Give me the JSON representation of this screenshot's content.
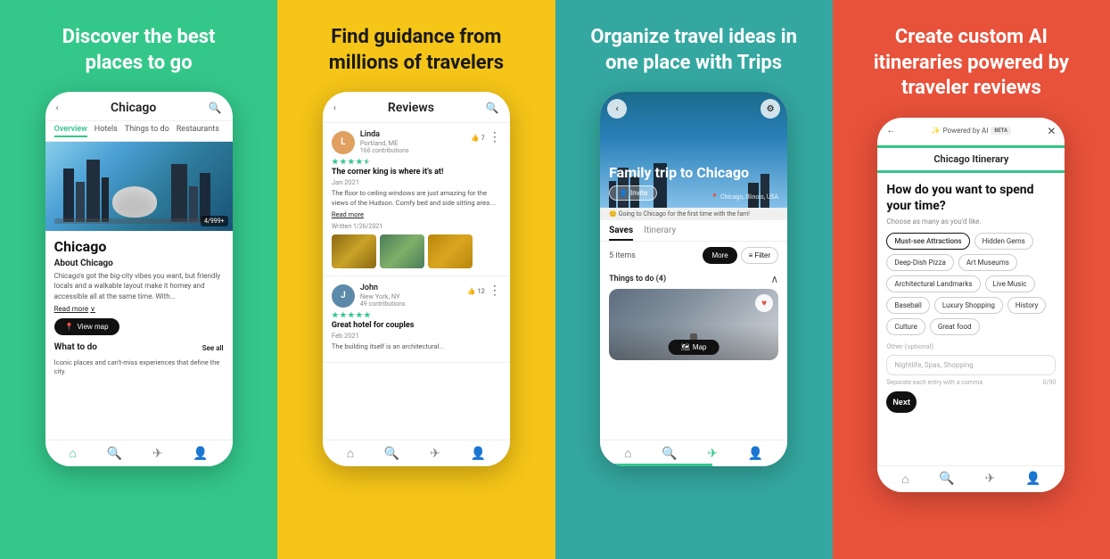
{
  "panels": [
    {
      "id": "panel-1",
      "title": "Discover the best places to go",
      "bg": "#34C78A",
      "phone": {
        "header": {
          "back_icon": "‹",
          "title": "Chicago",
          "search_icon": "🔍"
        },
        "tabs": [
          "Overview",
          "Hotels",
          "Things to do",
          "Restaurants"
        ],
        "active_tab": "Overview",
        "hero_count": "4/999+",
        "city_name": "Chicago",
        "about_title": "About Chicago",
        "about_text": "Chicago's got the big-city vibes you want, but friendly locals and a walkable layout make it homey and accessible all at the same time. With...",
        "read_more": "Read more",
        "view_map": "View map",
        "what_to_do": "What to do",
        "see_all": "See all",
        "what_desc": "Iconic places and can't-miss experiences that define the city."
      }
    },
    {
      "id": "panel-2",
      "title": "Find guidance from millions of travelers",
      "bg": "#F5C518",
      "phone": {
        "header": {
          "back_icon": "‹",
          "title": "Reviews",
          "search_icon": "🔍"
        },
        "reviews": [
          {
            "name": "Linda",
            "location": "Portland, ME",
            "contributions": "166 contributions",
            "stars": 4.5,
            "likes": 7,
            "title": "The corner king is where it's at!",
            "date": "Jan 2021",
            "text": "The floor to ceiling windows are just amazing for the views of the Hudson. Comfy bed and side sitting area....",
            "read_more": "Read more",
            "written": "Written 1/26/2021",
            "has_photos": true
          },
          {
            "name": "John",
            "location": "New York, NY",
            "contributions": "49 contributions",
            "stars": 5,
            "likes": 12,
            "title": "Great hotel for couples",
            "date": "Feb 2021",
            "text": "The building itself is an architectural...",
            "read_more": "",
            "written": "",
            "has_photos": false
          }
        ]
      }
    },
    {
      "id": "panel-3",
      "title": "Organize travel ideas in one place with Trips",
      "bg": "#34A8A0",
      "phone": {
        "trip_title": "Family trip to Chicago",
        "invite_label": "Invite",
        "location": "Chicago, Illinois, USA",
        "trip_desc": "😊 Going to Chicago for the first time with the fam!",
        "tabs": [
          "Saves",
          "Itinerary"
        ],
        "active_tab": "Saves",
        "items_count": "5 items",
        "more_btn": "More",
        "filter_btn": "Filter",
        "section_title": "Things to do (4)",
        "map_btn": "Map"
      }
    },
    {
      "id": "panel-4",
      "title": "Create custom AI itineraries powered by traveler reviews",
      "bg": "#E8513A",
      "phone": {
        "powered_by": "Powered by AI",
        "beta": "BETA",
        "itinerary_title": "Chicago Itinerary",
        "question": "How do you want to spend your time?",
        "subtitle": "Choose as many as you'd like.",
        "tags": [
          "Must-see Attractions",
          "Hidden Gems",
          "Deep-Dish Pizza",
          "Art Museums",
          "Architectural Landmarks",
          "Live Music",
          "Baseball",
          "Luxury Shopping",
          "History",
          "Culture",
          "Great food"
        ],
        "other_label": "Other",
        "other_optional": "(optional)",
        "input_placeholder": "Nightlife, Spas, Shopping",
        "input_hint": "Separate each entry with a comma",
        "char_count": "0/90",
        "next_btn": "Next"
      }
    }
  ]
}
